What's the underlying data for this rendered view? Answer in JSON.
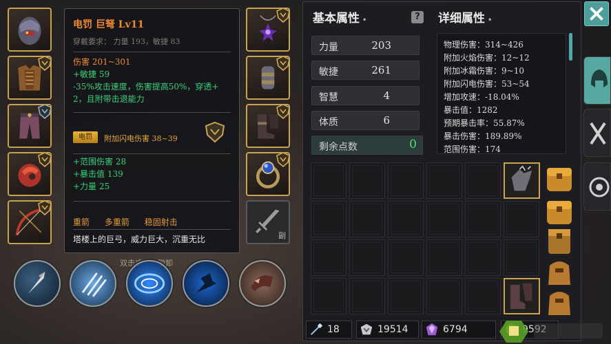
{
  "item_tooltip": {
    "name": "电罚 巨弩 Lv11",
    "requirement": "穿戴要求：  力量 193，敏捷 83",
    "damage": "伤害  201~301",
    "agility_bonus": "+敏捷 59",
    "special_line1": " -35%攻击速度，伤害提高50%，穿透+",
    "special_line2": "2，且附带击退能力",
    "socket_tag": "电罚",
    "socket_effect": "附加闪电伤害 38~39",
    "extra_stats": [
      "+范围伤害 28",
      "+暴击值 139",
      "+力量 25"
    ],
    "traits": [
      "重箭",
      "多重箭",
      "稳固射击"
    ],
    "description": "塔楼上的巨弓，威力巨大，沉重无比"
  },
  "hint_text": "双击或拖拽脱卸",
  "secondary_slot_label": "副",
  "basic_attributes": {
    "title": "基本属性",
    "rows": [
      {
        "label": "力量",
        "value": "203"
      },
      {
        "label": "敏捷",
        "value": "261"
      },
      {
        "label": "智慧",
        "value": "4"
      },
      {
        "label": "体质",
        "value": "6"
      }
    ],
    "remaining_label": "剩余点数",
    "remaining_value": "0"
  },
  "help_icon_text": "?",
  "detailed_attributes": {
    "title": "详细属性",
    "lines": [
      "物理伤害：314~426",
      "附加火焰伤害：12~12",
      "附加冰霜伤害：9~10",
      "附加闪电伤害：53~54",
      "增加攻速：-18.04%",
      "暴击值：1282",
      "预期暴击率：55.87%",
      "暴击伤害：189.89%",
      "范围伤害：174"
    ]
  },
  "currency": {
    "arrows": "18",
    "silver": "19514",
    "gems": "6794",
    "gold": "9592"
  },
  "colors": {
    "item_name": "#f08a2e",
    "bonus_green": "#34d27b",
    "remaining_points": "#4ee26c",
    "accent_teal": "#56a8a2",
    "slot_gold": "#c7a24f"
  },
  "icons": {
    "close": "close-icon",
    "help": "help-icon",
    "tab_helmet": "helmet-icon",
    "tab_bag": "bag-icon",
    "tab_settings": "settings-icon"
  }
}
